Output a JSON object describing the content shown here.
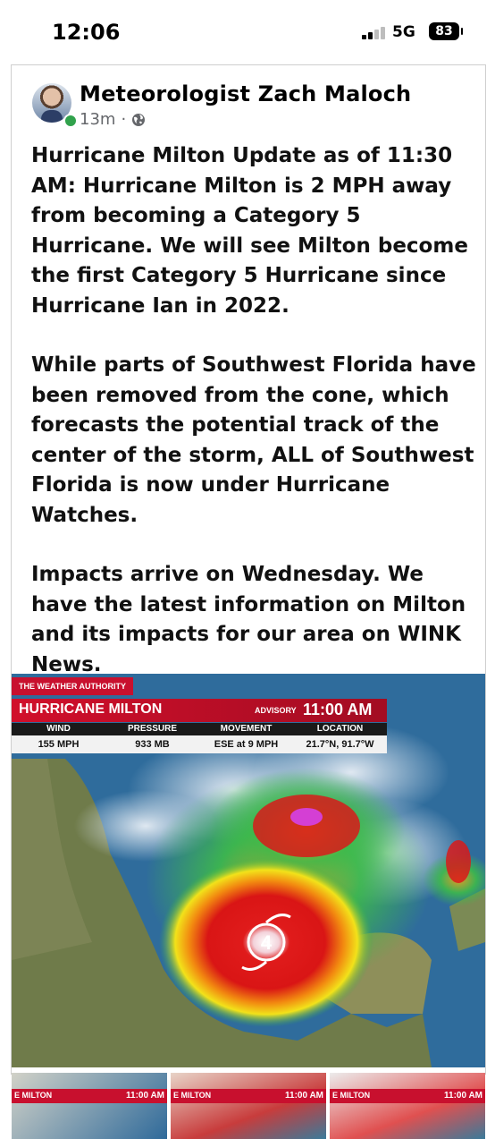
{
  "status_bar": {
    "time": "12:06",
    "network": "5G",
    "battery": "83"
  },
  "post": {
    "author": "Meteorologist Zach Maloch",
    "time_ago": "13m",
    "separator": "·",
    "paragraphs": [
      "Hurricane Milton Update as of 11:30 AM: Hurricane Milton is 2 MPH away from becoming a Category 5 Hurricane. We will see Milton become the first Category 5 Hurricane since Hurricane Ian in 2022.",
      "While parts of Southwest Florida have been removed from the cone, which forecasts the potential track of the center of the storm, ALL of Southwest Florida is now under Hurricane Watches.",
      "Impacts arrive on Wednesday. We have the latest information on Milton and its impacts for our area on WINK News."
    ]
  },
  "graphic": {
    "brand": "THE WEATHER AUTHORITY",
    "storm_name": "HURRICANE MILTON",
    "advisory_label": "ADVISORY",
    "advisory_time": "11:00 AM",
    "headers": [
      "WIND",
      "PRESSURE",
      "MOVEMENT",
      "LOCATION"
    ],
    "values": [
      "155 MPH",
      "933 MB",
      "ESE at 9 MPH",
      "21.7°N, 91.7°W"
    ],
    "category": "4"
  },
  "thumbnails": [
    {
      "name": "E MILTON",
      "time": "11:00 AM"
    },
    {
      "name": "E MILTON",
      "time": "11:00 AM"
    },
    {
      "name": "E MILTON",
      "time": "11:00 AM"
    }
  ],
  "colors": {
    "accent_red": "#c8102e",
    "meta_gray": "#65676b",
    "online_green": "#31a24c"
  }
}
